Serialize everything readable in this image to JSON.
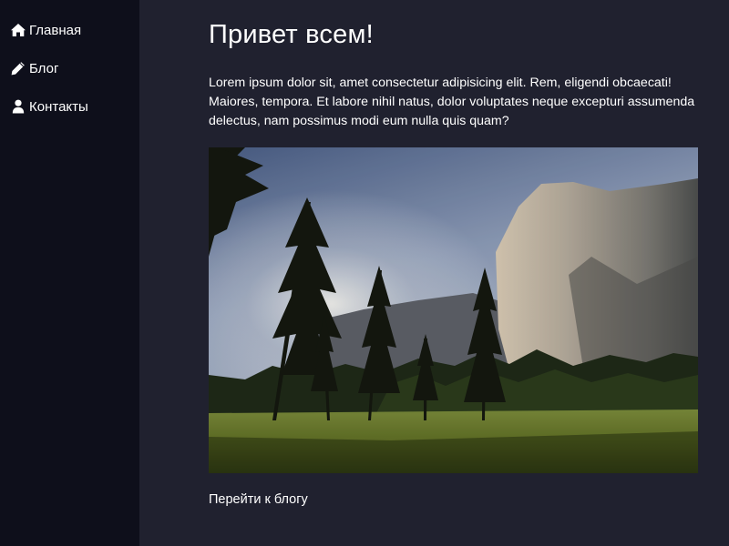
{
  "sidebar": {
    "items": [
      {
        "label": "Главная",
        "icon": "home-icon"
      },
      {
        "label": "Блог",
        "icon": "pencil-icon"
      },
      {
        "label": "Контакты",
        "icon": "user-icon"
      }
    ]
  },
  "main": {
    "title": "Привет всем!",
    "paragraph": "Lorem ipsum dolor sit, amet consectetur adipisicing elit. Rem, eligendi obcaecati! Maiores, tempora. Et labore nihil natus, dolor voluptates neque excepturi assumenda delectus, nam possimus modi eum nulla quis quam?",
    "image": {
      "subject": "mountain-valley-photo"
    },
    "link": "Перейти к блогу"
  },
  "colors": {
    "sidebar_bg": "#0e0f1b",
    "main_bg": "#20212f",
    "text": "#ffffff"
  }
}
